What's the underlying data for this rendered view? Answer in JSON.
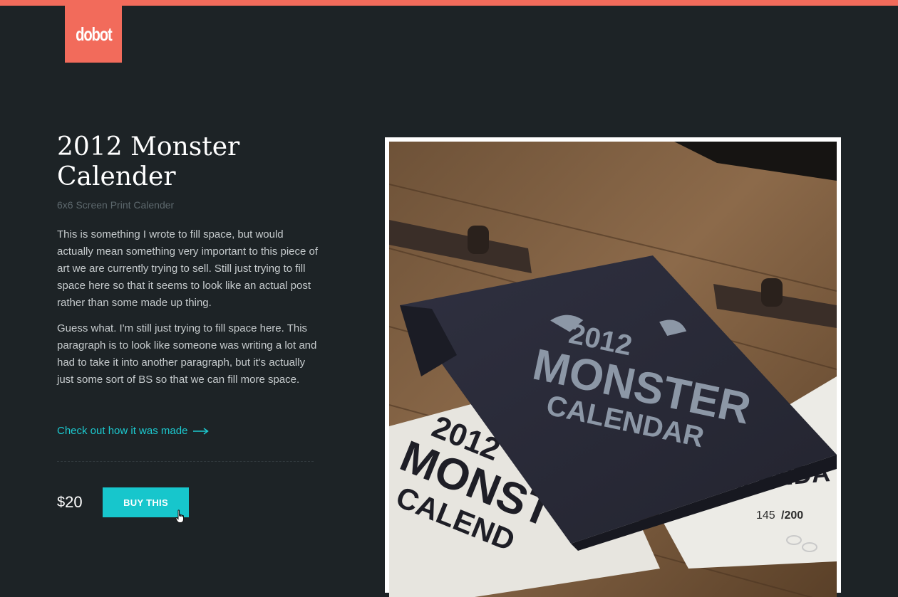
{
  "brand": {
    "logo_text": "dobot",
    "accent_color": "#f26b5b"
  },
  "product": {
    "title": "2012 Monster Calender",
    "subtitle": "6x6 Screen Print Calender",
    "description": [
      "This is something I wrote to fill space, but would actually mean something very important to this piece of art we are currently trying to sell. Still just trying to fill space here so that it seems to look like an actual post rather than some made up thing.",
      "Guess what. I'm still just trying to fill space here. This paragraph is to look like someone was writing a lot and had to take it into another paragraph, but it's actually just some sort of BS so that we can fill more space."
    ],
    "link_text": "Check out how it was made",
    "link_icon": "long-arrow-right-icon",
    "currency_symbol": "$",
    "price_amount": "20",
    "buy_label": "BUY THIS",
    "link_color": "#1cc9cf"
  },
  "photo": {
    "cover_line1": "2012",
    "cover_line2": "MONSTER",
    "cover_line3": "CALENDAR",
    "edition_number": "145",
    "edition_total": "/200"
  }
}
